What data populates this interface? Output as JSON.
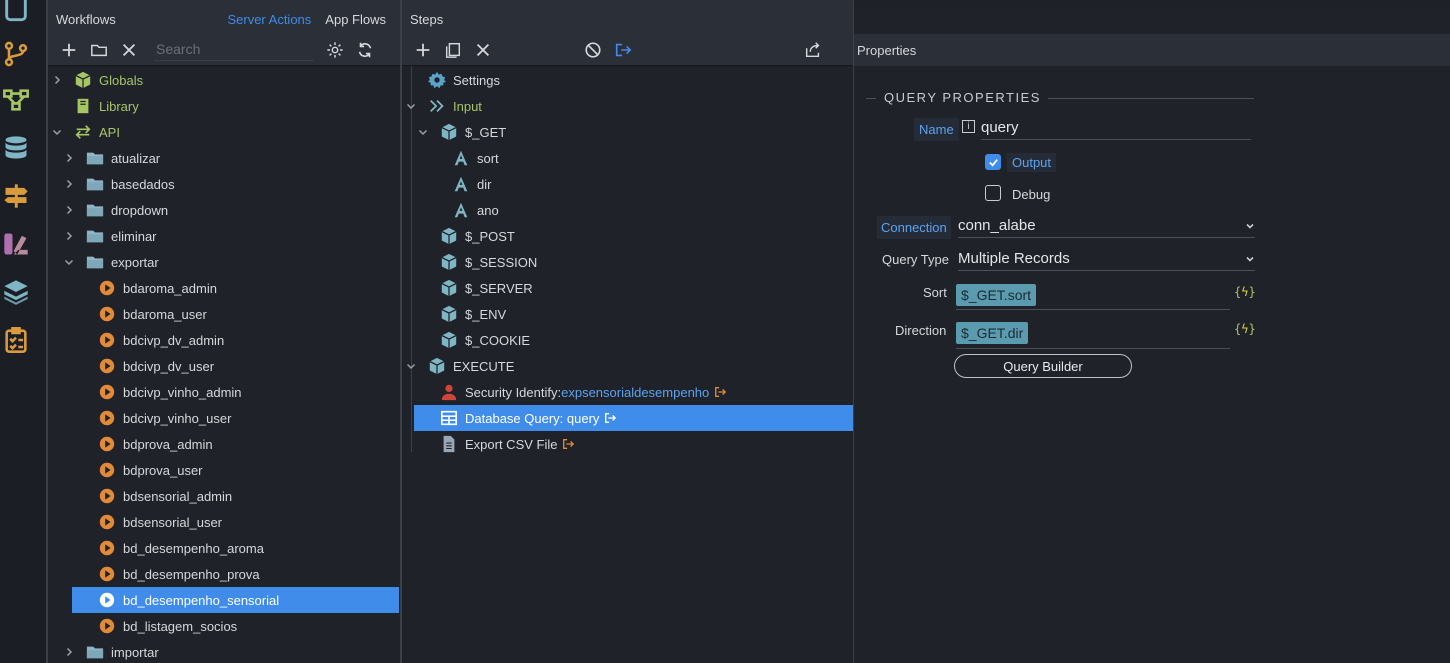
{
  "colors": {
    "accent": "#3f8cea",
    "green": "#a8c564",
    "orange": "#e08a3a",
    "cyan": "#7fb6c4",
    "red": "#d0453a"
  },
  "workflows": {
    "title": "Workflows",
    "tab_server": "Server Actions",
    "tab_app": "App Flows",
    "search_placeholder": "Search",
    "toolbar_icons": [
      "add-icon",
      "folder-icon",
      "close-icon",
      "gear-icon",
      "refresh-icon"
    ],
    "tree": [
      {
        "label": "Globals",
        "icon": "cube-icon",
        "chevron": "right",
        "level": 0,
        "style": "green"
      },
      {
        "label": "Library",
        "icon": "library-icon",
        "chevron": "none",
        "level": 0,
        "style": "green"
      },
      {
        "label": "API",
        "icon": "swap-arrows-icon",
        "chevron": "down",
        "level": 0,
        "style": "green"
      },
      {
        "label": "atualizar",
        "icon": "folder-icon",
        "chevron": "right",
        "level": 1
      },
      {
        "label": "basedados",
        "icon": "folder-icon",
        "chevron": "right",
        "level": 1
      },
      {
        "label": "dropdown",
        "icon": "folder-icon",
        "chevron": "right",
        "level": 1
      },
      {
        "label": "eliminar",
        "icon": "folder-icon",
        "chevron": "right",
        "level": 1
      },
      {
        "label": "exportar",
        "icon": "folder-icon",
        "chevron": "down",
        "level": 1
      },
      {
        "label": "bdaroma_admin",
        "icon": "play-icon",
        "chevron": "none",
        "level": 2
      },
      {
        "label": "bdaroma_user",
        "icon": "play-icon",
        "chevron": "none",
        "level": 2
      },
      {
        "label": "bdcivp_dv_admin",
        "icon": "play-icon",
        "chevron": "none",
        "level": 2
      },
      {
        "label": "bdcivp_dv_user",
        "icon": "play-icon",
        "chevron": "none",
        "level": 2
      },
      {
        "label": "bdcivp_vinho_admin",
        "icon": "play-icon",
        "chevron": "none",
        "level": 2
      },
      {
        "label": "bdcivp_vinho_user",
        "icon": "play-icon",
        "chevron": "none",
        "level": 2
      },
      {
        "label": "bdprova_admin",
        "icon": "play-icon",
        "chevron": "none",
        "level": 2
      },
      {
        "label": "bdprova_user",
        "icon": "play-icon",
        "chevron": "none",
        "level": 2
      },
      {
        "label": "bdsensorial_admin",
        "icon": "play-icon",
        "chevron": "none",
        "level": 2
      },
      {
        "label": "bdsensorial_user",
        "icon": "play-icon",
        "chevron": "none",
        "level": 2
      },
      {
        "label": "bd_desempenho_aroma",
        "icon": "play-icon",
        "chevron": "none",
        "level": 2
      },
      {
        "label": "bd_desempenho_prova",
        "icon": "play-icon",
        "chevron": "none",
        "level": 2
      },
      {
        "label": "bd_desempenho_sensorial",
        "icon": "play-icon",
        "chevron": "none",
        "level": 2,
        "selected": true
      },
      {
        "label": "bd_listagem_socios",
        "icon": "play-icon",
        "chevron": "none",
        "level": 2
      },
      {
        "label": "importar",
        "icon": "folder-icon",
        "chevron": "right",
        "level": 1
      }
    ]
  },
  "steps": {
    "title": "Steps",
    "toolbar_icons": [
      "add-icon",
      "copy-icon",
      "close-icon",
      "disable-icon",
      "output-icon"
    ],
    "tree": [
      {
        "label": "Settings",
        "icon": "gear-icon",
        "chevron": "none",
        "level": 0
      },
      {
        "label": "Input",
        "icon": "input-icon",
        "chevron": "down",
        "level": 0,
        "style": "green"
      },
      {
        "label": "$_GET",
        "icon": "cube-icon",
        "chevron": "down",
        "level": 1
      },
      {
        "label": "sort",
        "icon": "text-a-icon",
        "chevron": "none",
        "level": 2
      },
      {
        "label": "dir",
        "icon": "text-a-icon",
        "chevron": "none",
        "level": 2
      },
      {
        "label": "ano",
        "icon": "text-a-icon",
        "chevron": "none",
        "level": 2
      },
      {
        "label": "$_POST",
        "icon": "cube-icon",
        "chevron": "none",
        "level": 1
      },
      {
        "label": "$_SESSION",
        "icon": "cube-icon",
        "chevron": "none",
        "level": 1
      },
      {
        "label": "$_SERVER",
        "icon": "cube-icon",
        "chevron": "none",
        "level": 1
      },
      {
        "label": "$_ENV",
        "icon": "cube-icon",
        "chevron": "none",
        "level": 1
      },
      {
        "label": "$_COOKIE",
        "icon": "cube-icon",
        "chevron": "none",
        "level": 1
      },
      {
        "label": "EXECUTE",
        "icon": "cube-icon",
        "chevron": "down",
        "level": 0
      },
      {
        "label": "Security Identify: ",
        "suffix": "expsensorialdesempenho",
        "icon": "user-icon",
        "chevron": "none",
        "level": 1,
        "output": true
      },
      {
        "label": "Database Query: query",
        "icon": "table-icon",
        "chevron": "none",
        "level": 1,
        "output": true,
        "selected": true
      },
      {
        "label": "Export CSV File",
        "icon": "file-icon",
        "chevron": "none",
        "level": 1,
        "output": true
      }
    ]
  },
  "properties": {
    "title": "Properties",
    "section": "QUERY PROPERTIES",
    "name_label": "Name",
    "name_value": "query",
    "output_label": "Output",
    "output_checked": true,
    "debug_label": "Debug",
    "debug_checked": false,
    "connection_label": "Connection",
    "connection_value": "conn_alabe",
    "query_type_label": "Query Type",
    "query_type_value": "Multiple Records",
    "sort_label": "Sort",
    "sort_value": "$_GET.sort",
    "direction_label": "Direction",
    "direction_value": "$_GET.dir",
    "query_builder_label": "Query Builder"
  }
}
